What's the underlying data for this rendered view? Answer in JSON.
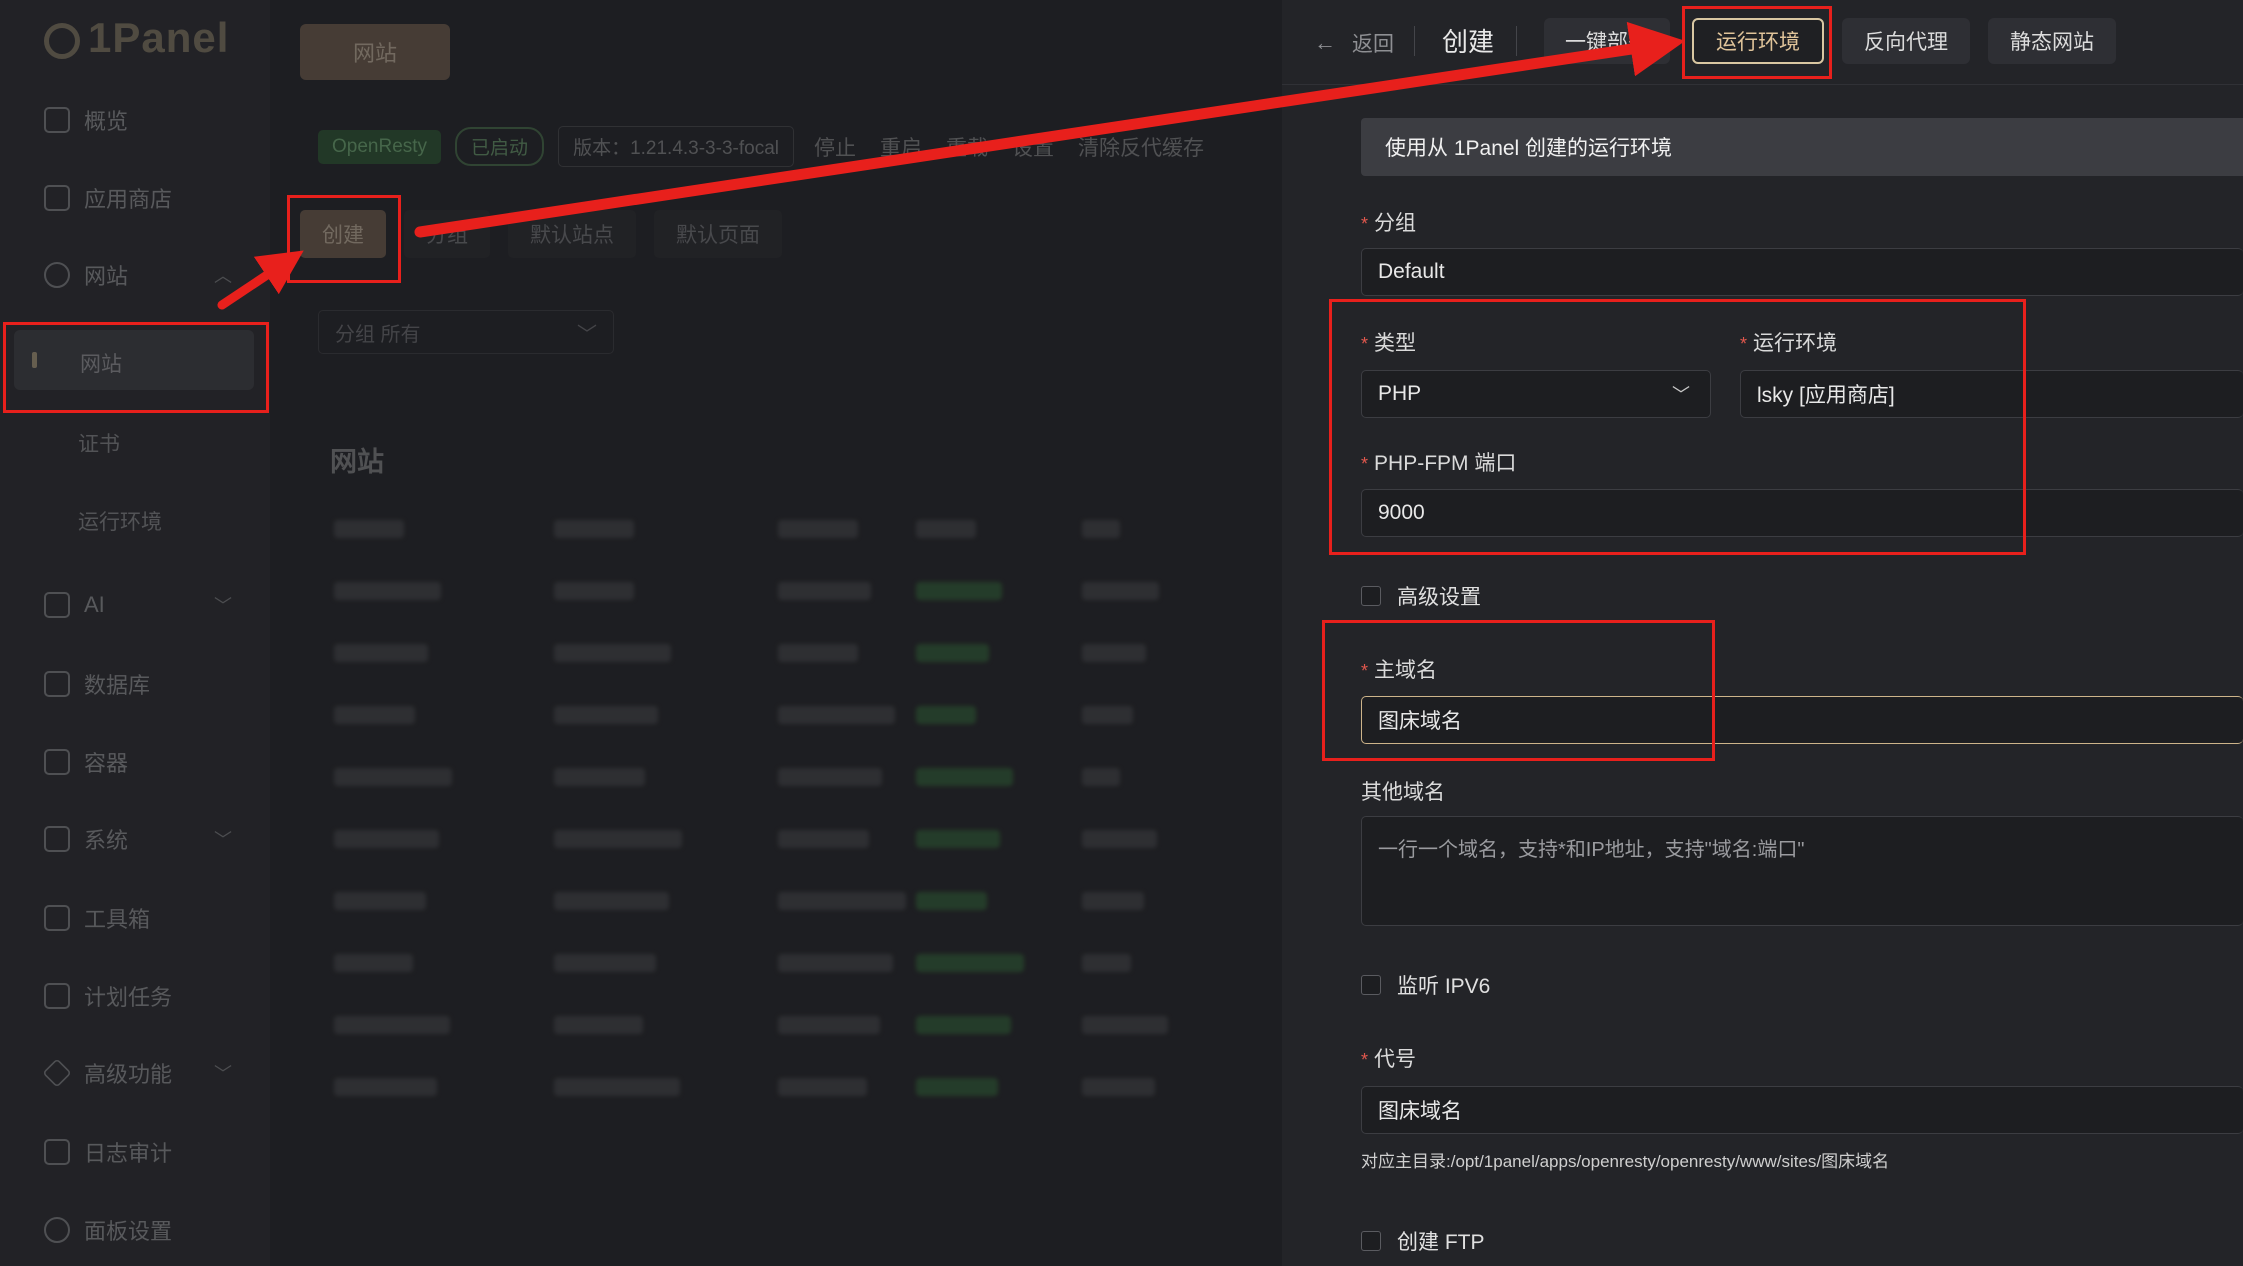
{
  "sidebar": {
    "logo": "1Panel",
    "items": [
      {
        "label": "概览",
        "icon": "home-icon"
      },
      {
        "label": "应用商店",
        "icon": "grid-icon"
      },
      {
        "label": "网站",
        "icon": "globe-icon"
      },
      {
        "label": "AI",
        "icon": "robot-icon"
      },
      {
        "label": "数据库",
        "icon": "layers-icon"
      },
      {
        "label": "容器",
        "icon": "docker-icon"
      },
      {
        "label": "系统",
        "icon": "system-icon"
      },
      {
        "label": "工具箱",
        "icon": "toolbox-icon"
      },
      {
        "label": "计划任务",
        "icon": "calendar-icon"
      },
      {
        "label": "高级功能",
        "icon": "diamond-icon"
      },
      {
        "label": "日志审计",
        "icon": "log-icon"
      },
      {
        "label": "面板设置",
        "icon": "settings-icon"
      }
    ],
    "subitems": {
      "website": "网站",
      "cert": "证书",
      "runtime": "运行环境"
    }
  },
  "main": {
    "top_button": "网站",
    "toolbar": {
      "openresty": "OpenResty",
      "status": "已启动",
      "version": "版本：1.21.4.3-3-3-focal",
      "actions": [
        "停止",
        "重启",
        "重载",
        "设置",
        "清除反代缓存"
      ]
    },
    "tabs": [
      "创建",
      "分组",
      "默认站点",
      "默认页面"
    ],
    "group_filter": "分组  所有",
    "section_title": "网站"
  },
  "drawer": {
    "back": "返回",
    "title": "创建",
    "tabs": [
      "一键部署",
      "运行环境",
      "反向代理",
      "静态网站"
    ],
    "active_tab": "运行环境",
    "alert": "使用从 1Panel 创建的运行环境",
    "group": {
      "label": "分组",
      "value": "Default"
    },
    "type": {
      "label": "类型",
      "value": "PHP"
    },
    "runtime": {
      "label": "运行环境",
      "value": "lsky [应用商店]"
    },
    "fpm_port": {
      "label": "PHP-FPM 端口",
      "value": "9000"
    },
    "advanced": "高级设置",
    "primary_domain": {
      "label": "主域名",
      "value": "图床域名"
    },
    "other_domains": {
      "label": "其他域名",
      "placeholder": "一行一个域名，支持*和IP地址，支持\"域名:端口\""
    },
    "ipv6": "监听 IPV6",
    "alias": {
      "label": "代号",
      "value": "图床域名"
    },
    "dir_hint": "对应主目录:/opt/1panel/apps/openresty/openresty/www/sites/图床域名",
    "ftp": "创建 FTP"
  },
  "colors": {
    "annotation": "#e8201c",
    "accent": "#d9c7a2"
  }
}
